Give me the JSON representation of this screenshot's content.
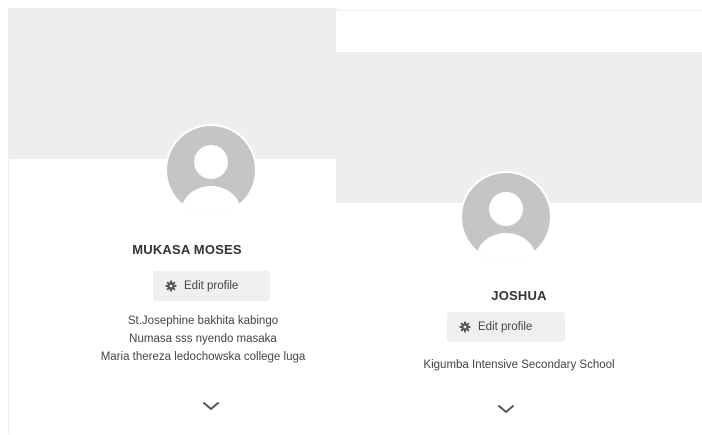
{
  "cards": [
    {
      "name": "MUKASA MOSES",
      "edit_label": "Edit profile",
      "schools": [
        "St.Josephine bakhita kabingo",
        "Numasa sss nyendo masaka",
        "Maria thereza ledochowska college luga"
      ]
    },
    {
      "name": "JOSHUA",
      "edit_label": "Edit profile",
      "schools": [
        "Kigumba Intensive Secondary School"
      ]
    }
  ],
  "colors": {
    "cover": "#eeeeee",
    "avatar": "#c5c5c5",
    "button_bg": "#efefef",
    "text": "#444444"
  },
  "icons": [
    "avatar-placeholder-icon",
    "gear-icon",
    "chevron-down-icon"
  ]
}
